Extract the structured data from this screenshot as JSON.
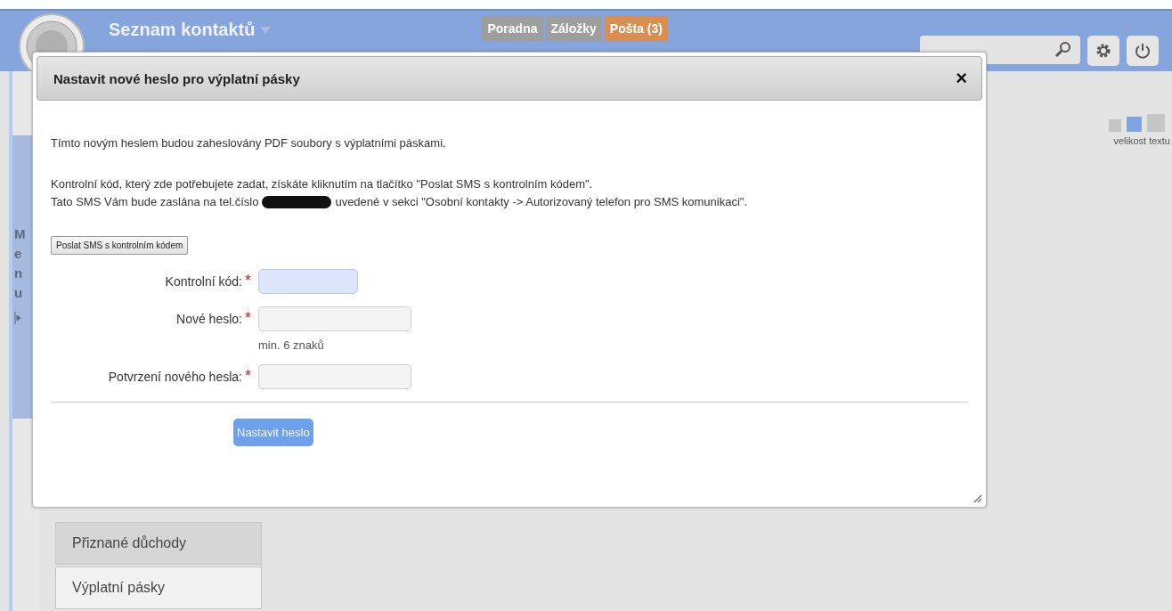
{
  "header": {
    "title": "Seznam kontaktů",
    "tabs": [
      {
        "label": "Poradna",
        "selected": false
      },
      {
        "label": "Záložky",
        "selected": false
      },
      {
        "label": "Pošta (3)",
        "selected": true
      }
    ]
  },
  "text_size": {
    "label": "velikost textu",
    "options": [
      {
        "selected": false
      },
      {
        "selected": true
      },
      {
        "selected": false
      }
    ]
  },
  "side_menu": {
    "letters": [
      "M",
      "e",
      "n",
      "u"
    ]
  },
  "sidebar": {
    "items": [
      {
        "label": "Přiznané důchody",
        "selected": false
      },
      {
        "label": "Výplatní pásky",
        "selected": true
      }
    ]
  },
  "dialog": {
    "title": "Nastavit nové heslo pro výplatní pásky",
    "close": "×",
    "intro": "Tímto novým heslem budou zaheslovány PDF soubory s výplatními páskami.",
    "info_line_1": "Kontrolní kód, který zde potřebujete zadat, získáte kliknutím na tlačítko \"Poslat SMS s kontrolním kódem\".",
    "info_line_2_before": "Tato SMS Vám bude zaslána na tel.číslo",
    "info_line_2_after": "uvedené v sekci \"Osobní kontakty -> Autorizovaný telefon pro SMS komunikaci\".",
    "sms_button": "Poslat SMS s kontrolním kódem",
    "fields": [
      {
        "label": "Kontrolní kód:",
        "required_mark": "*",
        "focused": true
      },
      {
        "label": "Nové heslo:",
        "required_mark": "*",
        "focused": false,
        "hint": "min. 6 znaků"
      },
      {
        "label": "Potvrzení nového hesla:",
        "required_mark": "*",
        "focused": false
      }
    ],
    "submit": "Nastavit heslo"
  }
}
